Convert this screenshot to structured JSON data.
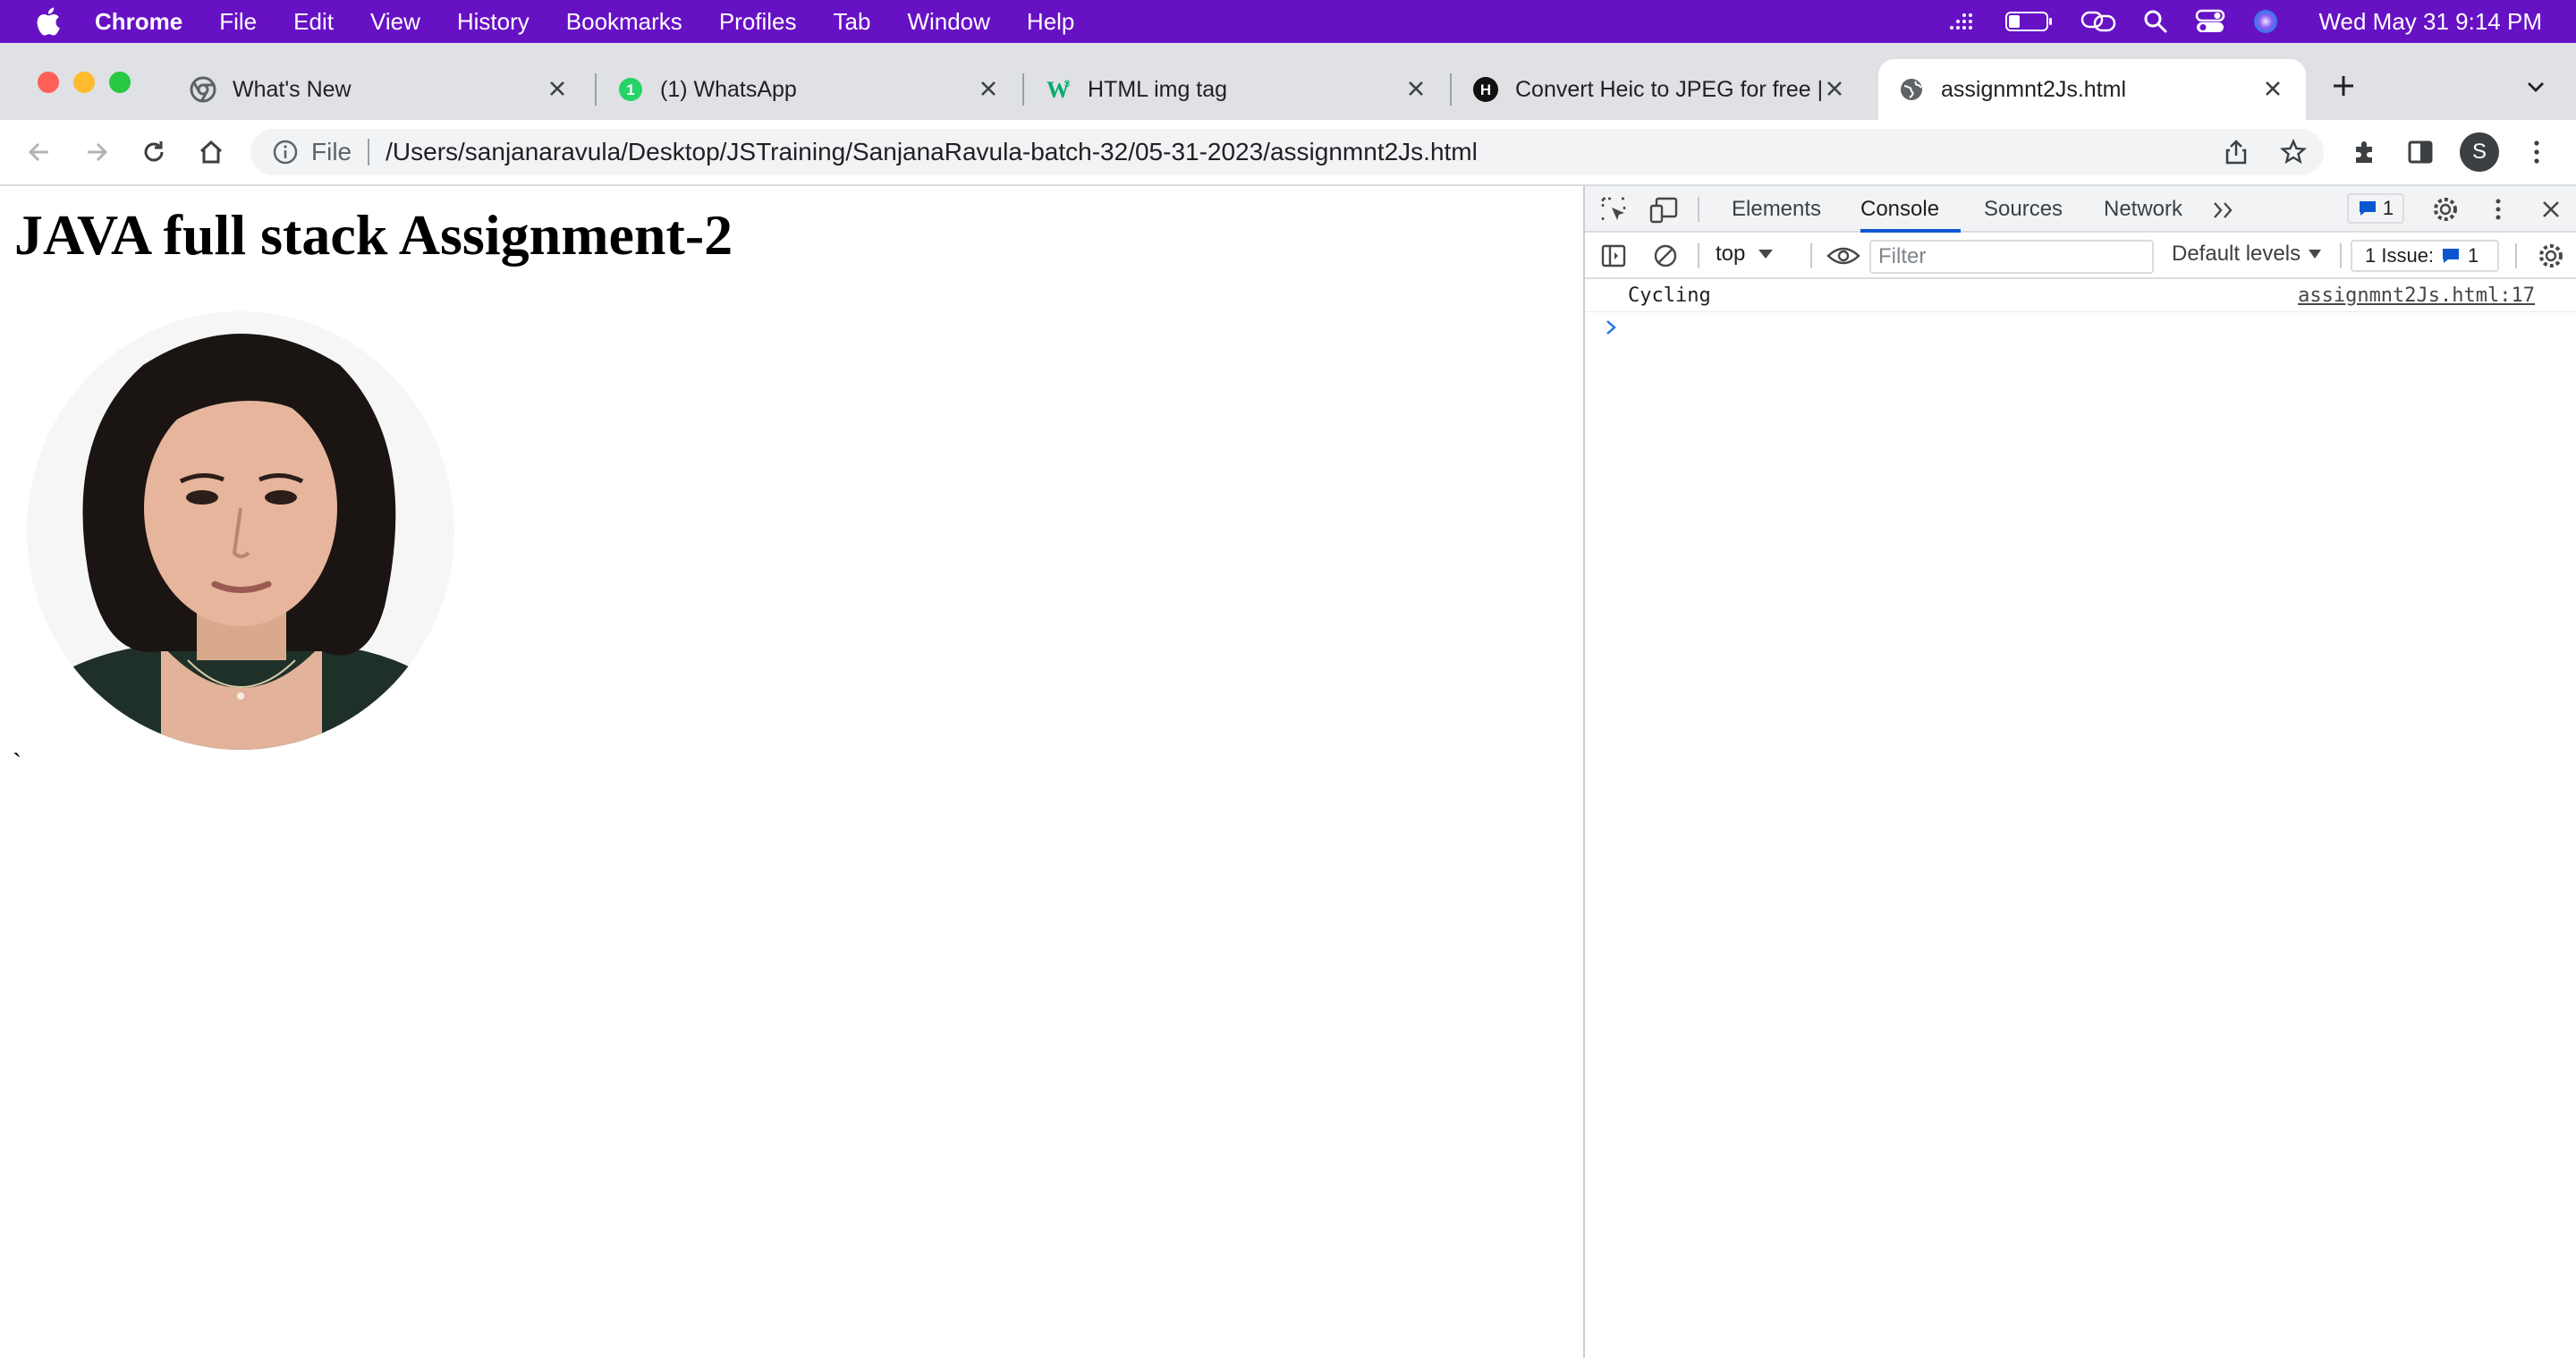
{
  "menubar": {
    "app": "Chrome",
    "items": [
      "File",
      "Edit",
      "View",
      "History",
      "Bookmarks",
      "Profiles",
      "Tab",
      "Window",
      "Help"
    ],
    "clock": "Wed May 31  9:14 PM"
  },
  "tabs": [
    {
      "title": "What's New",
      "icon": "chrome-icon"
    },
    {
      "title": "(1) WhatsApp",
      "icon": "whatsapp-icon",
      "badge": "1"
    },
    {
      "title": "HTML img tag",
      "icon": "w3schools-icon"
    },
    {
      "title": "Convert Heic to JPEG for free |",
      "icon": "heic-converter-icon"
    },
    {
      "title": "assignmnt2Js.html",
      "icon": "globe-icon"
    }
  ],
  "toolbar": {
    "scheme": "File",
    "url": "/Users/sanjanaravula/Desktop/JSTraining/SanjanaRavula-batch-32/05-31-2023/assignmnt2Js.html",
    "avatar_letter": "S"
  },
  "page": {
    "heading": "JAVA full stack Assignment-2",
    "trailing_text": "`"
  },
  "devtools": {
    "tabs": [
      "Elements",
      "Console",
      "Sources",
      "Network"
    ],
    "active_tab": "Console",
    "message_count": "1",
    "context": "top",
    "filter_placeholder": "Filter",
    "levels": "Default levels",
    "issues_label": "1 Issue:",
    "issues_count": "1",
    "console": [
      {
        "message": "Cycling",
        "source": "assignmnt2Js.html:17"
      }
    ]
  },
  "colors": {
    "menubar": "#6711c5",
    "tabstrip": "#dfe1e5",
    "accent": "#0b57d0"
  }
}
